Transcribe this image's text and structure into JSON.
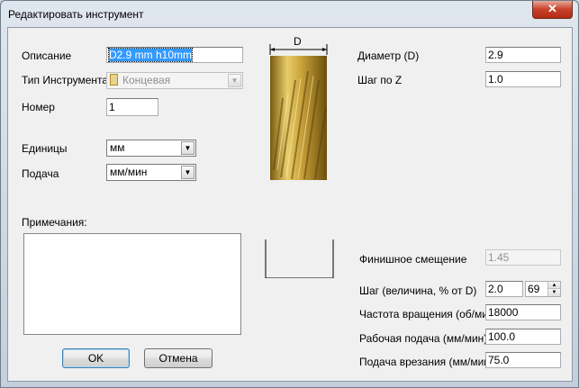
{
  "window": {
    "title": "Редактировать инструмент",
    "close_icon": "close-icon"
  },
  "form": {
    "description_label": "Описание",
    "description_value": "D2.9 mm h10mm",
    "tool_type_label": "Тип Инструмента",
    "tool_type_value": "Концевая",
    "number_label": "Номер",
    "number_value": "1",
    "units_label": "Единицы",
    "units_value": "мм",
    "feed_label": "Подача",
    "feed_value": "мм/мин",
    "notes_label": "Примечания:",
    "notes_value": ""
  },
  "diagram": {
    "diameter_marker": "D",
    "tool_color": "#c9a23a"
  },
  "params": {
    "diameter_label": "Диаметр (D)",
    "diameter_value": "2.9",
    "z_step_label": "Шаг по Z",
    "z_step_value": "1.0",
    "finish_offset_label": "Финишное смещение",
    "finish_offset_value": "1.45",
    "stepover_label": "Шаг (величина, % от D)",
    "stepover_value": "2.0",
    "stepover_percent": "69",
    "spindle_label": "Частота вращения (об/мин)",
    "spindle_value": "18000",
    "feed_rate_label": "Рабочая подача (мм/мин)",
    "feed_rate_value": "100.0",
    "plunge_label": "Подача врезания (мм/мин)",
    "plunge_value": "75.0"
  },
  "buttons": {
    "ok": "OK",
    "cancel": "Отмена"
  }
}
